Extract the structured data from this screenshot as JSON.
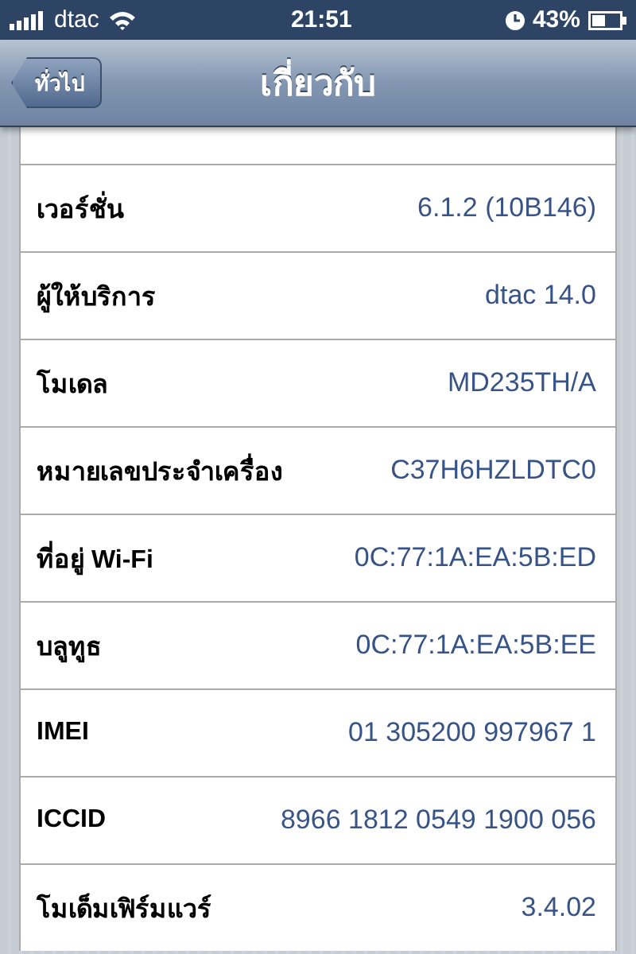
{
  "status_bar": {
    "carrier": "dtac",
    "time": "21:51",
    "battery": "43%"
  },
  "nav_bar": {
    "back": "ทั่วไป",
    "title": "เกี่ยวกับ"
  },
  "rows": [
    {
      "label": "เวอร์ชั่น",
      "value": "6.1.2 (10B146)"
    },
    {
      "label": "ผู้ให้บริการ",
      "value": "dtac 14.0"
    },
    {
      "label": "โมเดล",
      "value": "MD235TH/A"
    },
    {
      "label": "หมายเลขประจำเครื่อง",
      "value": "C37H6HZLDTC0"
    },
    {
      "label": "ที่อยู่ Wi-Fi",
      "value": "0C:77:1A:EA:5B:ED"
    },
    {
      "label": "บลูทูธ",
      "value": "0C:77:1A:EA:5B:EE"
    },
    {
      "label": "IMEI",
      "value": "01 305200 997967 1"
    },
    {
      "label": "ICCID",
      "value": "8966 1812 0549 1900 056"
    },
    {
      "label": "โมเด็มเฟิร์มแวร์",
      "value": "3.4.02"
    }
  ]
}
